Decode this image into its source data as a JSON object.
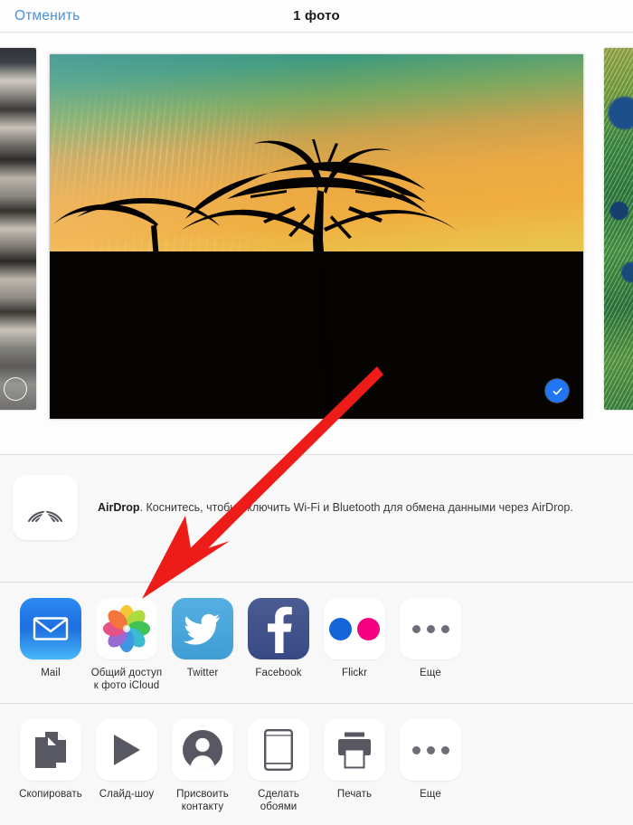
{
  "navbar": {
    "cancel_label": "Отменить",
    "title": "1 фото"
  },
  "photo_strip": {
    "selected_badge_icon": "checkmark-circle-icon",
    "left_thumb_name": "previous-photo-thumbnail",
    "right_thumb_name": "next-photo-thumbnail",
    "main_photo_name": "selected-photo-preview"
  },
  "airdrop": {
    "icon": "airdrop-icon",
    "title": "AirDrop",
    "text": ". Коснитесь, чтобы включить Wi-Fi и Bluetooth для обмена данными через AirDrop."
  },
  "share_apps": [
    {
      "label": "Mail",
      "icon": "mail-icon"
    },
    {
      "label": "Общий доступ к фото iCloud",
      "icon": "icloud-photo-sharing-icon"
    },
    {
      "label": "Twitter",
      "icon": "twitter-icon"
    },
    {
      "label": "Facebook",
      "icon": "facebook-icon"
    },
    {
      "label": "Flickr",
      "icon": "flickr-icon"
    },
    {
      "label": "Еще",
      "icon": "more-icon"
    }
  ],
  "actions": [
    {
      "label": "Скопировать",
      "icon": "copy-icon"
    },
    {
      "label": "Слайд-шоу",
      "icon": "play-icon"
    },
    {
      "label": "Присвоить контакту",
      "icon": "contact-icon"
    },
    {
      "label": "Сделать обоями",
      "icon": "wallpaper-icon"
    },
    {
      "label": "Печать",
      "icon": "printer-icon"
    },
    {
      "label": "Еще",
      "icon": "more-icon"
    }
  ],
  "annotation": {
    "name": "red-arrow-annotation",
    "color": "#ee1c18",
    "points_to": "Общий доступ к фото iCloud"
  },
  "colors": {
    "accent_blue": "#4a90d9",
    "selection_blue": "#2076f5",
    "background": "#f8f8f8",
    "separator": "#dcdcdc"
  }
}
